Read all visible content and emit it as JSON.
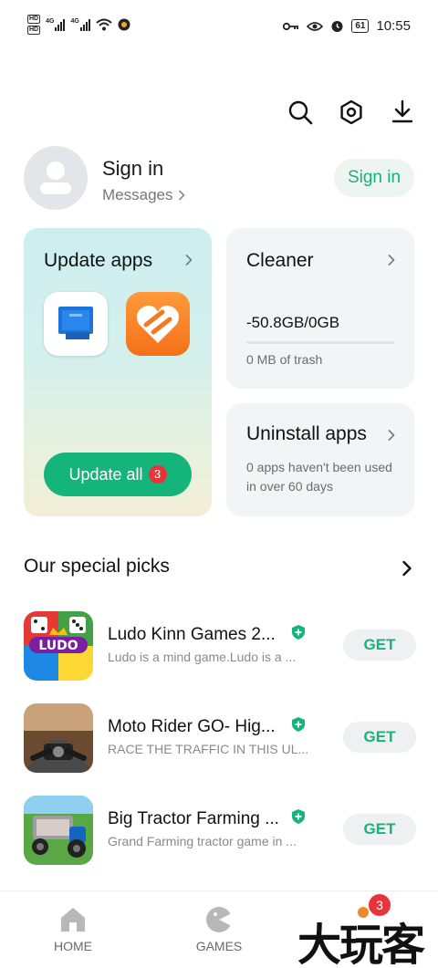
{
  "status_bar": {
    "hd_labels": [
      "HD",
      "HD"
    ],
    "signal_labels": [
      "4G",
      "4G"
    ],
    "battery": "61",
    "time": "10:55"
  },
  "profile": {
    "title": "Sign in",
    "messages_label": "Messages",
    "sign_in_button": "Sign in"
  },
  "cards": {
    "update": {
      "title": "Update apps",
      "button_label": "Update all",
      "badge_count": "3"
    },
    "cleaner": {
      "title": "Cleaner",
      "value": "-50.8GB/0GB",
      "progress_fraction": 0,
      "subtitle": "0 MB of trash"
    },
    "uninstall": {
      "title": "Uninstall apps",
      "subtitle": "0 apps haven't been used in over 60 days"
    }
  },
  "special_picks": {
    "title": "Our special picks",
    "apps": [
      {
        "name": "Ludo Kinn Games 2...",
        "description": "Ludo is a mind game.Ludo is a ...",
        "button": "GET",
        "icon": "ludo-king-icon",
        "icon_text": "LUDO"
      },
      {
        "name": "Moto Rider GO- Hig...",
        "description": "RACE THE TRAFFIC IN THIS UL...",
        "button": "GET",
        "icon": "moto-rider-icon"
      },
      {
        "name": "Big Tractor Farming ...",
        "description": "Grand Farming tractor game in ...",
        "button": "GET",
        "icon": "tractor-farming-icon"
      }
    ]
  },
  "bottom_nav": {
    "home": "HOME",
    "games": "GAMES",
    "badge": "3"
  },
  "watermark": "大玩客",
  "colors": {
    "accent": "#15b47a",
    "badge": "#e8333a"
  }
}
